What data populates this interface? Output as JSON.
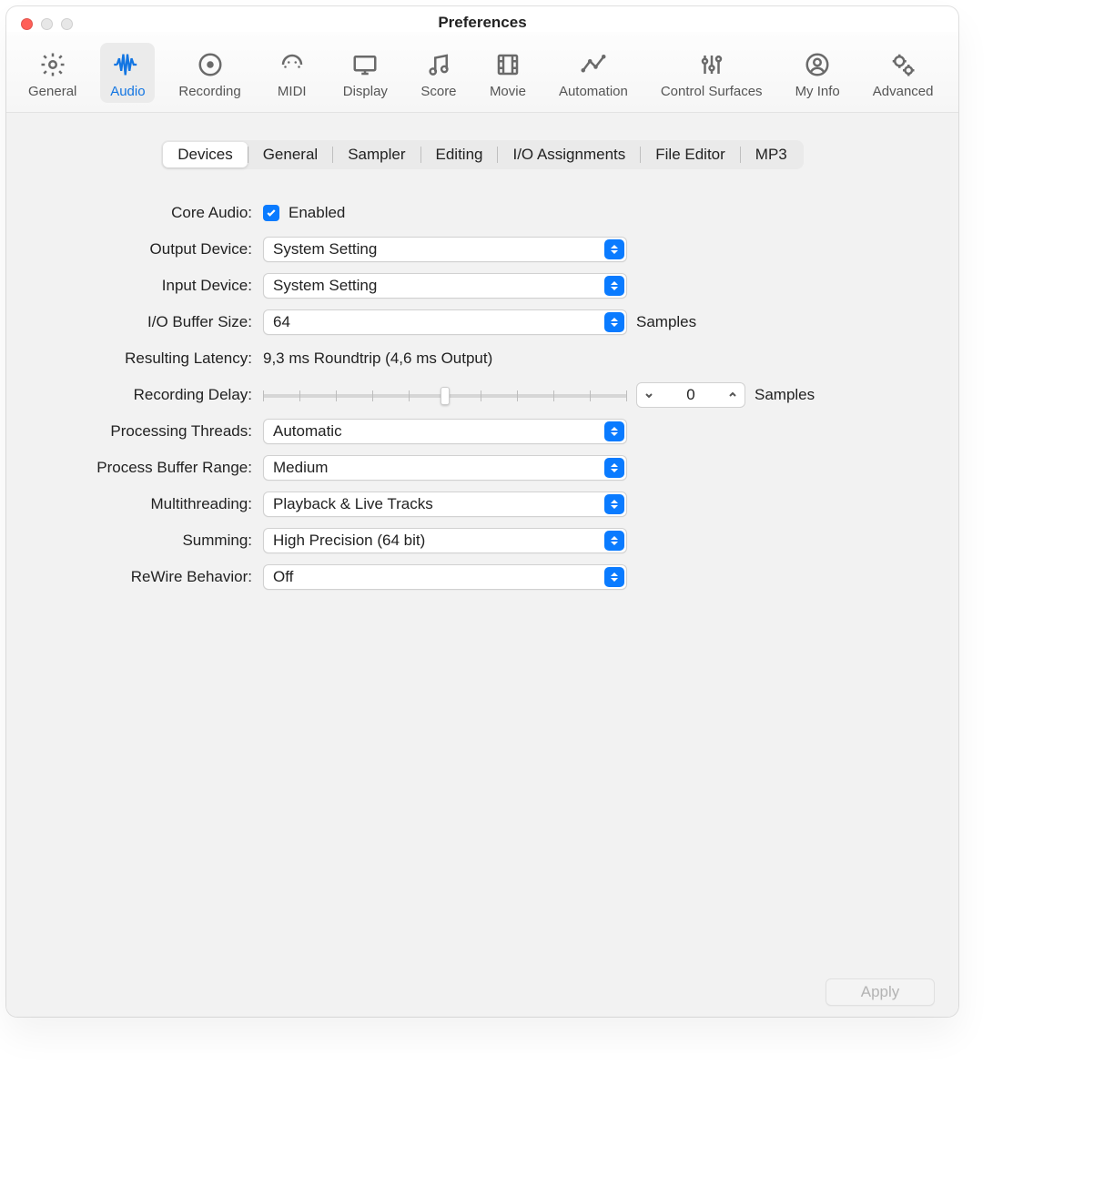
{
  "window": {
    "title": "Preferences"
  },
  "toolbar": {
    "items": [
      {
        "id": "general",
        "label": "General"
      },
      {
        "id": "audio",
        "label": "Audio"
      },
      {
        "id": "recording",
        "label": "Recording"
      },
      {
        "id": "midi",
        "label": "MIDI"
      },
      {
        "id": "display",
        "label": "Display"
      },
      {
        "id": "score",
        "label": "Score"
      },
      {
        "id": "movie",
        "label": "Movie"
      },
      {
        "id": "automation",
        "label": "Automation"
      },
      {
        "id": "surfaces",
        "label": "Control Surfaces"
      },
      {
        "id": "myinfo",
        "label": "My Info"
      },
      {
        "id": "advanced",
        "label": "Advanced"
      }
    ],
    "active": "audio"
  },
  "subtabs": {
    "items": [
      "Devices",
      "General",
      "Sampler",
      "Editing",
      "I/O Assignments",
      "File Editor",
      "MP3"
    ],
    "active": 0
  },
  "form": {
    "core_audio": {
      "label": "Core Audio:",
      "enabled_text": "Enabled",
      "checked": true
    },
    "output_device": {
      "label": "Output Device:",
      "value": "System Setting"
    },
    "input_device": {
      "label": "Input Device:",
      "value": "System Setting"
    },
    "io_buffer": {
      "label": "I/O Buffer Size:",
      "value": "64",
      "unit": "Samples"
    },
    "latency": {
      "label": "Resulting Latency:",
      "value": "9,3 ms Roundtrip (4,6 ms Output)"
    },
    "rec_delay": {
      "label": "Recording Delay:",
      "value": "0",
      "unit": "Samples"
    },
    "threads": {
      "label": "Processing Threads:",
      "value": "Automatic"
    },
    "buffer_range": {
      "label": "Process Buffer Range:",
      "value": "Medium"
    },
    "multithreading": {
      "label": "Multithreading:",
      "value": "Playback & Live Tracks"
    },
    "summing": {
      "label": "Summing:",
      "value": "High Precision (64 bit)"
    },
    "rewire": {
      "label": "ReWire Behavior:",
      "value": "Off"
    }
  },
  "buttons": {
    "apply": "Apply"
  }
}
